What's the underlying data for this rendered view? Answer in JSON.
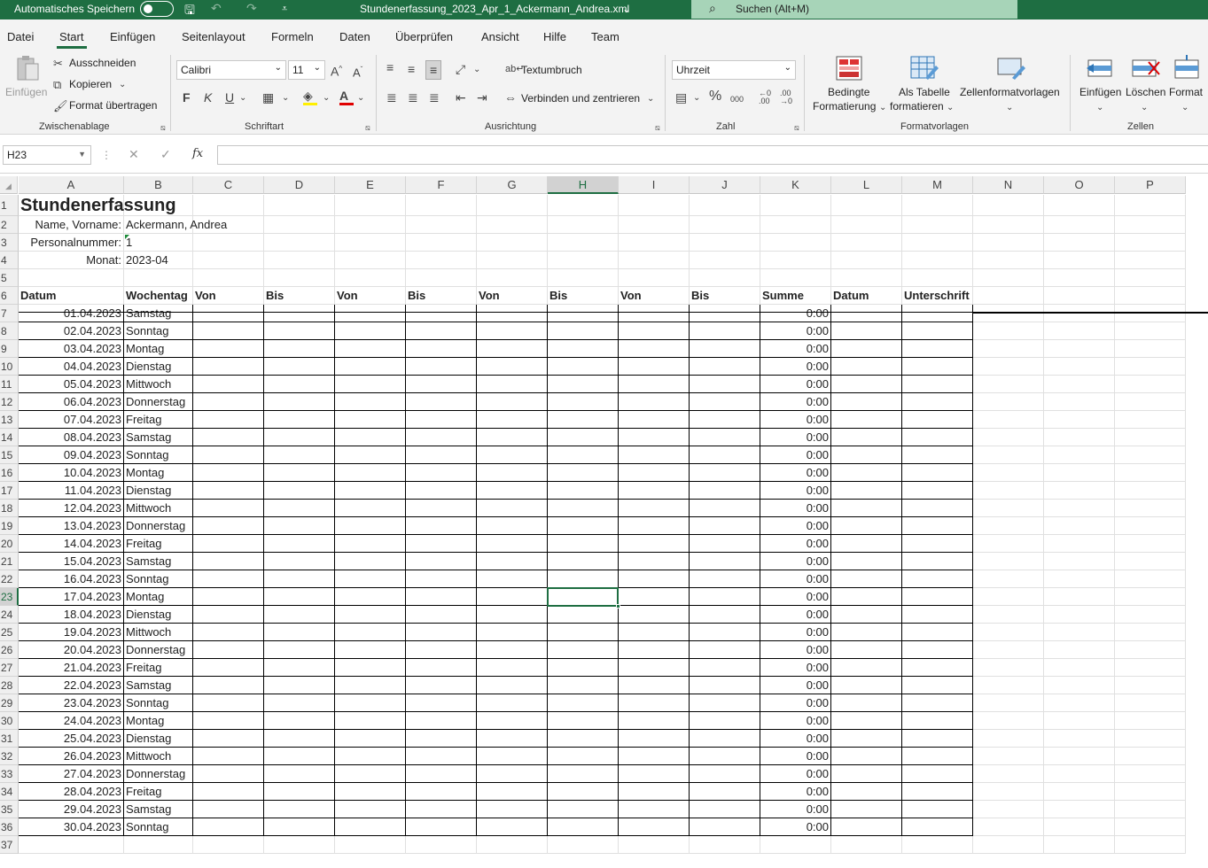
{
  "titlebar": {
    "autosave_label": "Automatisches Speichern",
    "file_title": "Stundenerfassung_2023_Apr_1_Ackermann_Andrea.xml",
    "search_placeholder": "Suchen (Alt+M)"
  },
  "menu": [
    "Datei",
    "Start",
    "Einfügen",
    "Seitenlayout",
    "Formeln",
    "Daten",
    "Überprüfen",
    "Ansicht",
    "Hilfe",
    "Team"
  ],
  "ribbon": {
    "clipboard": {
      "paste": "Einfügen",
      "cut": "Ausschneiden",
      "copy": "Kopieren",
      "format_painter": "Format übertragen",
      "group": "Zwischenablage"
    },
    "font": {
      "name": "Calibri",
      "size": "11",
      "group": "Schriftart",
      "bold": "F",
      "italic": "K",
      "underline": "U"
    },
    "alignment": {
      "wrap": "Textumbruch",
      "merge": "Verbinden und zentrieren",
      "group": "Ausrichtung"
    },
    "number": {
      "format": "Uhrzeit",
      "group": "Zahl",
      "percent": "%",
      "thousands": "000"
    },
    "styles": {
      "conditional": "Bedingte",
      "conditional2": "Formatierung",
      "as_table": "Als Tabelle",
      "as_table2": "formatieren",
      "cell_styles": "Zellenformatvorlagen",
      "group": "Formatvorlagen"
    },
    "cells": {
      "insert": "Einfügen",
      "delete": "Löschen",
      "format": "Format",
      "group": "Zellen"
    }
  },
  "formula_bar": {
    "name_box": "H23",
    "formula": ""
  },
  "columns": [
    "A",
    "B",
    "C",
    "D",
    "E",
    "F",
    "G",
    "H",
    "I",
    "J",
    "K",
    "L",
    "M",
    "N",
    "O",
    "P"
  ],
  "selected_column": "H",
  "selected_row": 23,
  "sheet": {
    "title": "Stundenerfassung",
    "name_label": "Name, Vorname:",
    "name_value": "Ackermann, Andrea",
    "pnr_label": "Personalnummer:",
    "pnr_value": "1",
    "month_label": "Monat:",
    "month_value": "2023-04",
    "headers": [
      "Datum",
      "Wochentag",
      "Von",
      "Bis",
      "Von",
      "Bis",
      "Von",
      "Bis",
      "Von",
      "Bis",
      "Summe",
      "Datum",
      "Unterschrift"
    ],
    "rows": [
      [
        "01.04.2023",
        "Samstag",
        "0:00"
      ],
      [
        "02.04.2023",
        "Sonntag",
        "0:00"
      ],
      [
        "03.04.2023",
        "Montag",
        "0:00"
      ],
      [
        "04.04.2023",
        "Dienstag",
        "0:00"
      ],
      [
        "05.04.2023",
        "Mittwoch",
        "0:00"
      ],
      [
        "06.04.2023",
        "Donnerstag",
        "0:00"
      ],
      [
        "07.04.2023",
        "Freitag",
        "0:00"
      ],
      [
        "08.04.2023",
        "Samstag",
        "0:00"
      ],
      [
        "09.04.2023",
        "Sonntag",
        "0:00"
      ],
      [
        "10.04.2023",
        "Montag",
        "0:00"
      ],
      [
        "11.04.2023",
        "Dienstag",
        "0:00"
      ],
      [
        "12.04.2023",
        "Mittwoch",
        "0:00"
      ],
      [
        "13.04.2023",
        "Donnerstag",
        "0:00"
      ],
      [
        "14.04.2023",
        "Freitag",
        "0:00"
      ],
      [
        "15.04.2023",
        "Samstag",
        "0:00"
      ],
      [
        "16.04.2023",
        "Sonntag",
        "0:00"
      ],
      [
        "17.04.2023",
        "Montag",
        "0:00"
      ],
      [
        "18.04.2023",
        "Dienstag",
        "0:00"
      ],
      [
        "19.04.2023",
        "Mittwoch",
        "0:00"
      ],
      [
        "20.04.2023",
        "Donnerstag",
        "0:00"
      ],
      [
        "21.04.2023",
        "Freitag",
        "0:00"
      ],
      [
        "22.04.2023",
        "Samstag",
        "0:00"
      ],
      [
        "23.04.2023",
        "Sonntag",
        "0:00"
      ],
      [
        "24.04.2023",
        "Montag",
        "0:00"
      ],
      [
        "25.04.2023",
        "Dienstag",
        "0:00"
      ],
      [
        "26.04.2023",
        "Mittwoch",
        "0:00"
      ],
      [
        "27.04.2023",
        "Donnerstag",
        "0:00"
      ],
      [
        "28.04.2023",
        "Freitag",
        "0:00"
      ],
      [
        "29.04.2023",
        "Samstag",
        "0:00"
      ],
      [
        "30.04.2023",
        "Sonntag",
        "0:00"
      ]
    ]
  },
  "colors": {
    "accent": "#1e6e42",
    "search_bg": "#a7d4b8"
  }
}
